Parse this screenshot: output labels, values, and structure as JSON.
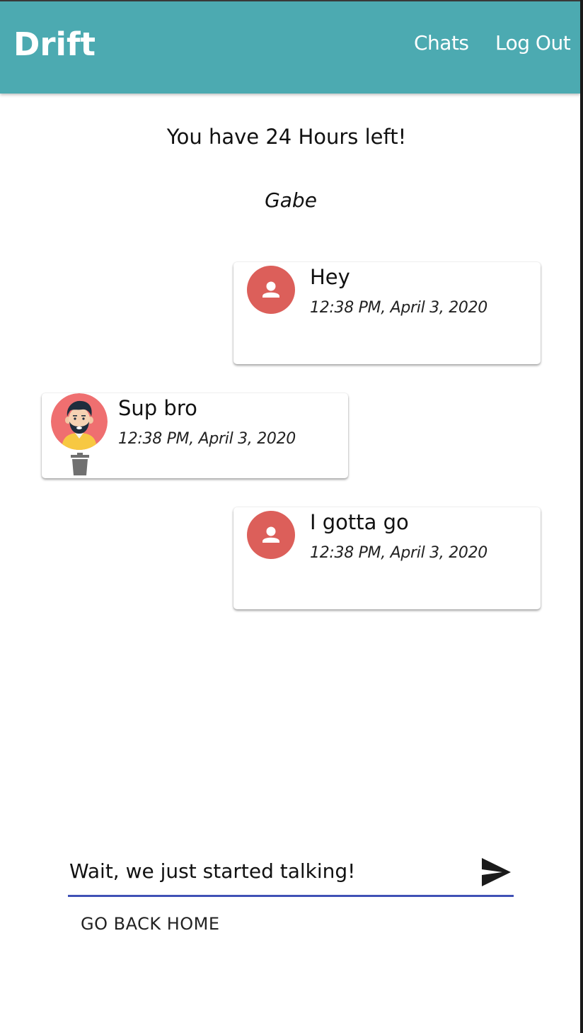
{
  "app": {
    "brand": "Drift",
    "nav": {
      "chats_label": "Chats",
      "logout_label": "Log Out"
    },
    "header_color": "#4caab1"
  },
  "chat": {
    "time_left": "You have 24 Hours left!",
    "partner_name": "Gabe",
    "messages": [
      {
        "side": "sent",
        "avatar": "person-icon",
        "text": "Hey",
        "time": "12:38 PM, April 3, 2020"
      },
      {
        "side": "received",
        "avatar": "bearded-man-avatar",
        "text": "Sup bro",
        "time": "12:38 PM, April 3, 2020",
        "action_icon": "trash-icon"
      },
      {
        "side": "sent",
        "avatar": "person-icon",
        "text": "I gotta go",
        "time": "12:38 PM, April 3, 2020"
      }
    ],
    "avatar_color": "#dc5f5a"
  },
  "composer": {
    "value": "Wait, we just started talking!",
    "send_icon": "send-icon",
    "underline_color": "#3f51b5"
  },
  "footer": {
    "home_label": "GO BACK HOME"
  }
}
